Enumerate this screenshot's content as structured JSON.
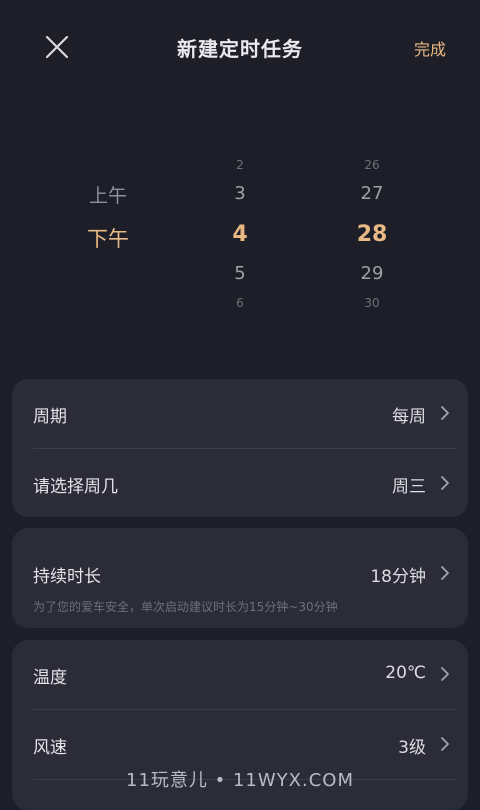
{
  "header": {
    "title": "新建定时任务",
    "done_label": "完成"
  },
  "picker": {
    "ampm": {
      "items": [
        "上午",
        "下午"
      ],
      "selected": "下午"
    },
    "hour": {
      "items": [
        "2",
        "3",
        "4",
        "5",
        "6"
      ],
      "selected": "4"
    },
    "minute": {
      "items": [
        "26",
        "27",
        "28",
        "29",
        "30"
      ],
      "selected": "28"
    }
  },
  "schedule": {
    "cycle": {
      "label": "周期",
      "value": "每周"
    },
    "weekday": {
      "label": "请选择周几",
      "value": "周三"
    }
  },
  "duration": {
    "label": "持续时长",
    "value": "18分钟",
    "hint": "为了您的爱车安全，单次启动建议时长为15分钟~30分钟"
  },
  "climate": {
    "temperature": {
      "label": "温度",
      "value": "20℃"
    },
    "fan": {
      "label": "风速",
      "value": "3级"
    }
  },
  "watermark": "11玩意儿 • 11WYX.COM",
  "colors": {
    "background": "#1d1e28",
    "card": "#2b2c38",
    "accent": "#e9b985"
  }
}
